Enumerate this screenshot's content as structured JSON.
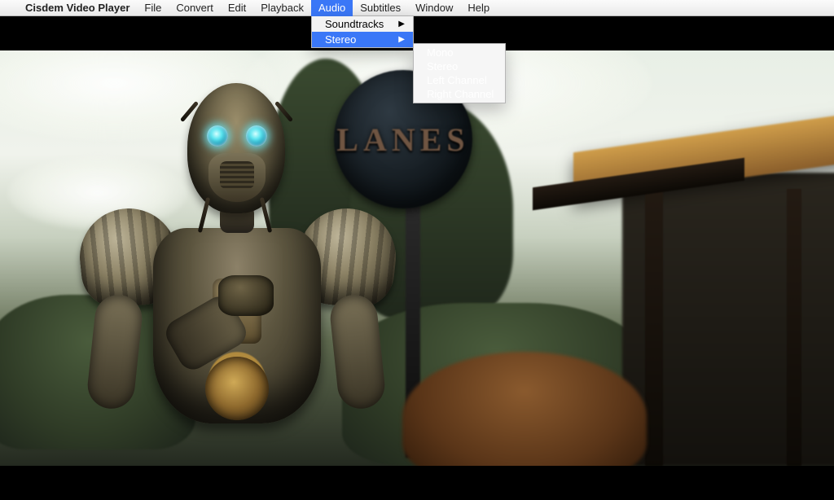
{
  "menubar": {
    "app_name": "Cisdem Video Player",
    "items": [
      "File",
      "Convert",
      "Edit",
      "Playback",
      "Audio",
      "Subtitles",
      "Window",
      "Help"
    ],
    "selected": "Audio"
  },
  "audio_menu": {
    "items": [
      {
        "label": "Soundtracks",
        "has_submenu": true,
        "highlight": false
      },
      {
        "label": "Stereo",
        "has_submenu": true,
        "highlight": true
      }
    ]
  },
  "stereo_submenu": {
    "items": [
      "Mono",
      "Stereo",
      "Left Channel",
      "Right Channel"
    ]
  },
  "scene": {
    "sign_text": "LANES"
  }
}
